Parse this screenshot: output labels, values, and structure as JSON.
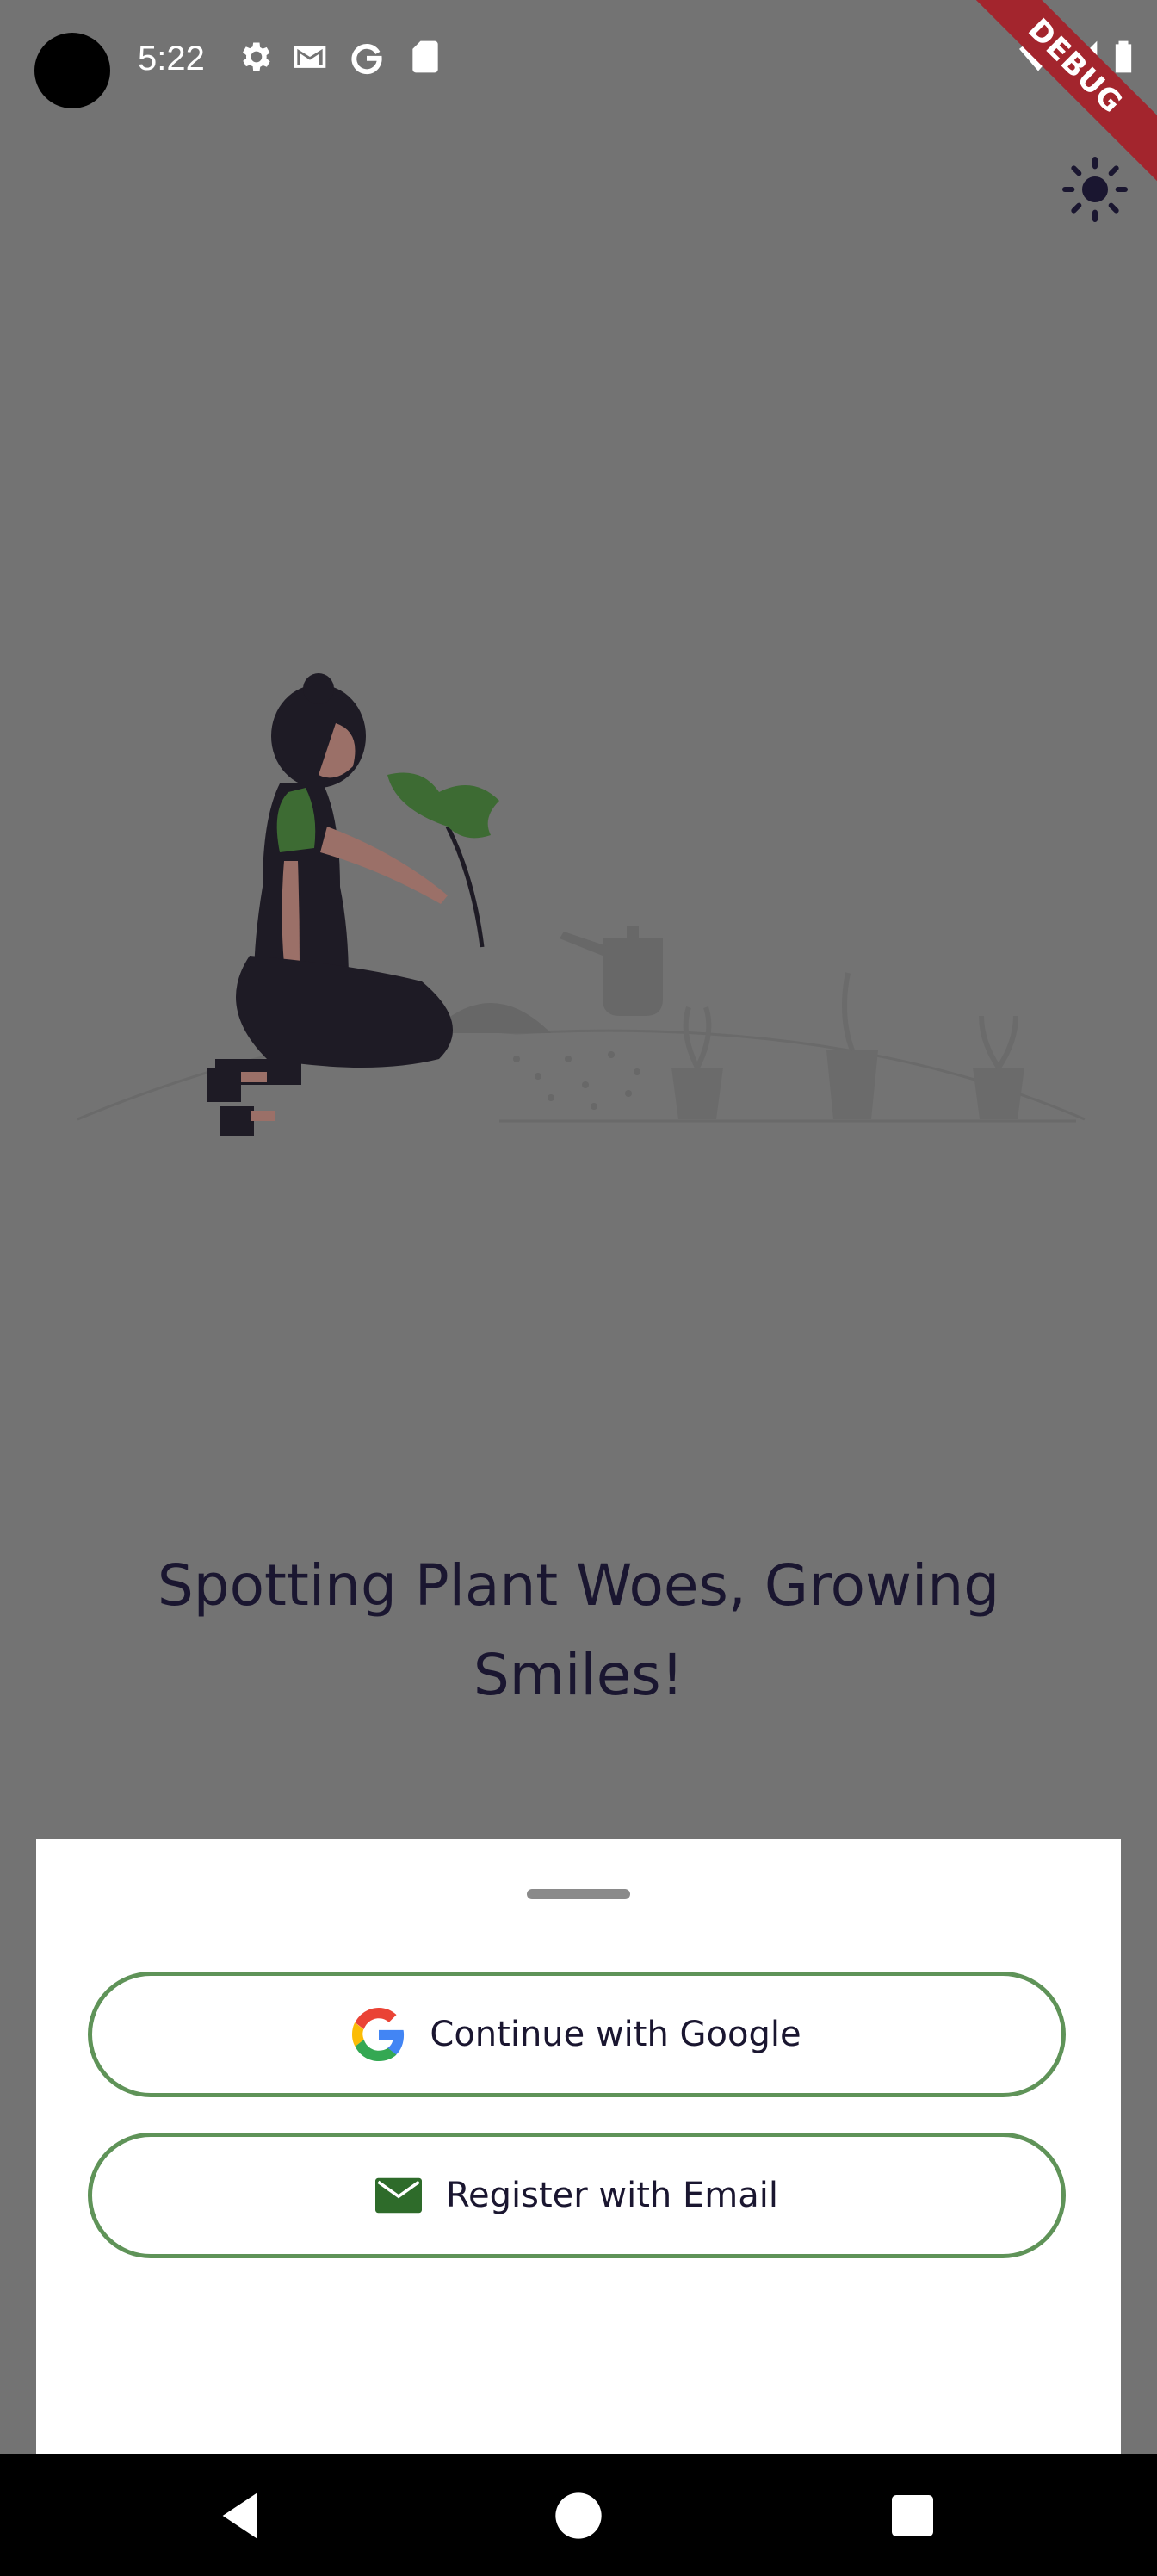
{
  "status_bar": {
    "time": "5:22",
    "left_icons": [
      "settings-icon",
      "gmail-icon",
      "google-icon",
      "sd-card-icon"
    ],
    "right_icons": [
      "wifi-icon",
      "signal-icon",
      "battery-icon"
    ],
    "debug_banner": "DEBUG"
  },
  "header": {
    "theme_toggle_icon": "sun-icon"
  },
  "hero": {
    "illustration": "woman-gardening-illustration",
    "tagline": "Spotting Plant Woes, Growing Smiles!"
  },
  "auth_sheet": {
    "google_button": {
      "label": "Continue with Google",
      "icon": "google-logo-icon"
    },
    "email_button": {
      "label": "Register with Email",
      "icon": "mail-icon"
    }
  },
  "nav_bar": {
    "buttons": [
      "back",
      "home",
      "recents"
    ]
  },
  "colors": {
    "overlay_background": "#737373",
    "accent_green": "#5f9358",
    "text_dark": "#1a1630",
    "debug_ribbon": "#a3252d"
  }
}
